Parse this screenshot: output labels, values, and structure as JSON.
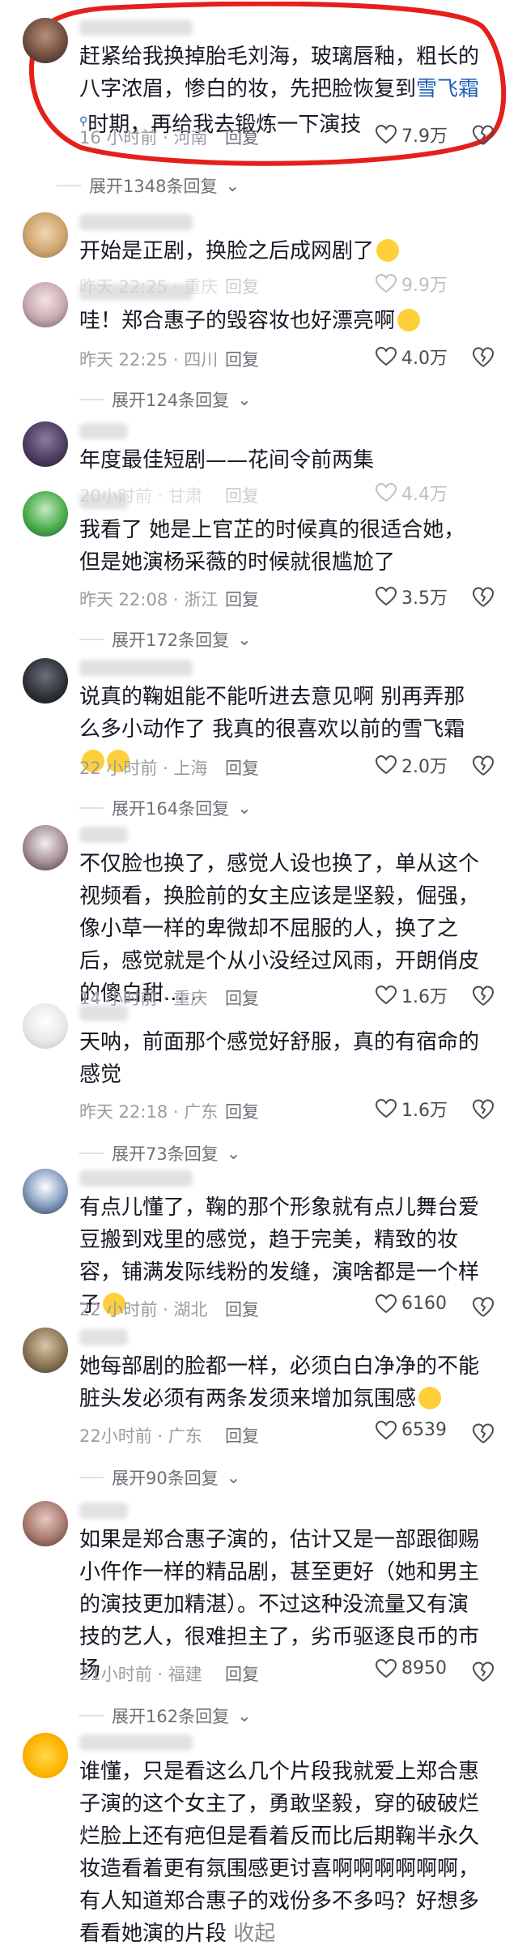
{
  "comments": [
    {
      "text": "赶紧给我换掉胎毛刘海，玻璃唇釉，粗长的八字浓眉，惨白的妆，先把脸恢复到",
      "link": "雪飞霜",
      "text_after": "时期，再给我去锻炼一下演技",
      "meta": "16 小时前 · 河南",
      "reply": "回复",
      "likes": "7.9万",
      "expand": "展开1348条回复"
    },
    {
      "text": "开始是正剧，换脸之后成网剧了",
      "meta": "昨天 22:25 · 重庆",
      "reply": "回复",
      "likes": "9.9万"
    },
    {
      "text": "哇！郑合惠子的毁容妆也好漂亮啊",
      "meta": "昨天 22:25 · 四川",
      "reply": "回复",
      "likes": "4.0万",
      "expand": "展开124条回复"
    },
    {
      "text": "年度最佳短剧——花间令前两集",
      "meta": "20小时前 · 甘肃",
      "reply": "回复",
      "likes": "4.4万"
    },
    {
      "text": "我看了 她是上官芷的时候真的很适合她，但是她演杨采薇的时候就很尴尬了",
      "meta": "昨天 22:08 · 浙江",
      "reply": "回复",
      "likes": "3.5万",
      "expand": "展开172条回复"
    },
    {
      "text": "说真的鞠姐能不能听进去意见啊 别再弄那么多小动作了 我真的很喜欢以前的雪飞霜",
      "meta": "22 小时前 · 上海",
      "reply": "回复",
      "likes": "2.0万",
      "expand": "展开164条回复"
    },
    {
      "text": "不仅脸也换了，感觉人设也换了，单从这个视频看，换脸前的女主应该是坚毅，倔强，像小草一样的卑微却不屈服的人，换了之后，感觉就是个从小没经过风雨，开朗俏皮的傻白甜......",
      "meta": "14 小时前 · 重庆",
      "reply": "回复",
      "likes": "1.6万"
    },
    {
      "text": "天呐，前面那个感觉好舒服，真的有宿命的感觉",
      "meta": "昨天 22:18 · 广东",
      "reply": "回复",
      "likes": "1.6万",
      "expand": "展开73条回复"
    },
    {
      "text": "有点儿懂了，鞠的那个形象就有点儿舞台爱豆搬到戏里的感觉，趋于完美，精致的妆容，铺满发际线粉的发缝，演啥都是一个样子",
      "meta": "22 小时前 · 湖北",
      "reply": "回复",
      "likes": "6160"
    },
    {
      "text": "她每部剧的脸都一样，必须白白净净的不能脏头发必须有两条发须来增加氛围感",
      "meta": "22小时前 · 广东",
      "reply": "回复",
      "likes": "6539",
      "expand": "展开90条回复"
    },
    {
      "text": "如果是郑合惠子演的，估计又是一部跟御赐小仵作一样的精品剧，甚至更好（她和男主的演技更加精湛）。不过这种没流量又有演技的艺人，很难担主了，劣币驱逐良币的市场",
      "meta": "21小时前 · 福建",
      "reply": "回复",
      "likes": "8950",
      "expand": "展开162条回复"
    },
    {
      "text": "谁懂，只是看这么几个片段我就爱上郑合惠子演的这个女主了，勇敢坚毅，穿的破破烂烂脸上还有疤但是看着反而比后期鞠半永久妆造看着更有氛围感更讨喜啊啊啊啊啊啊，有人知道郑合惠子的戏份多不多吗？好想多看看她演的片段",
      "fold": "收起"
    }
  ],
  "colors": {
    "text": "#161823",
    "meta": "#9b9ca3",
    "link": "#1f5fb8",
    "highlight": "#e5201b"
  }
}
